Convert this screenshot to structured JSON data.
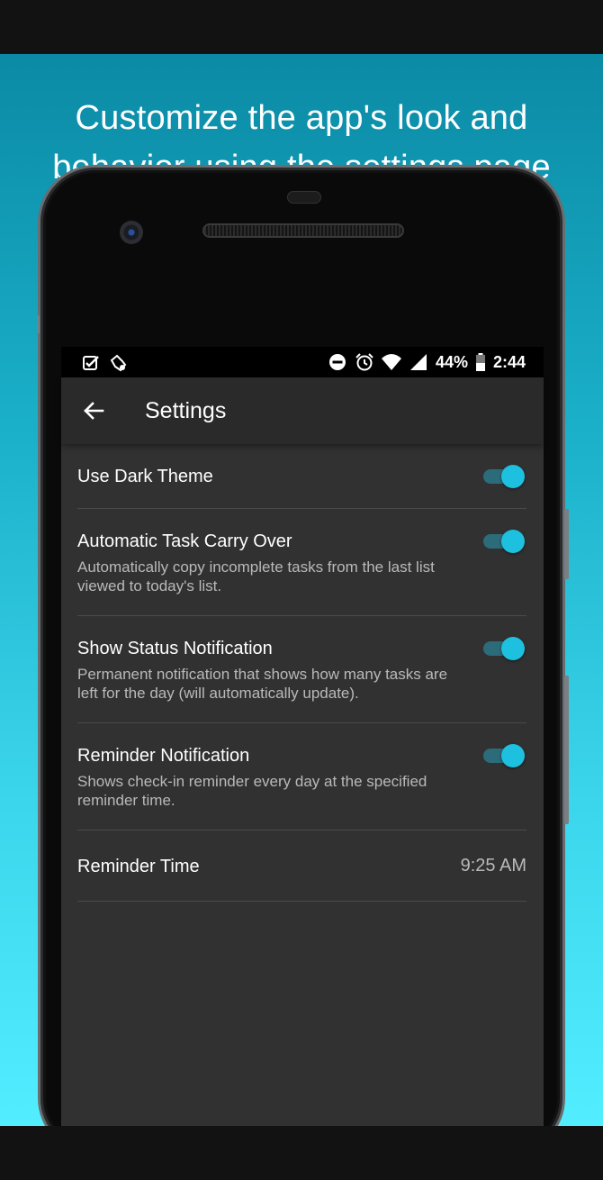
{
  "headline": {
    "line1": "Customize the app's look and",
    "line2": "behavior using the settings page"
  },
  "status_bar": {
    "left_icons": [
      "checkbox-notification-icon",
      "hand-notification-icon"
    ],
    "right_icons": [
      "do-not-disturb-icon",
      "alarm-icon",
      "wifi-icon",
      "signal-icon",
      "battery-icon"
    ],
    "battery": "44%",
    "time": "2:44"
  },
  "app_bar": {
    "back_icon": "arrow-back-icon",
    "title": "Settings"
  },
  "settings": [
    {
      "title": "Use Dark Theme",
      "description": "",
      "enabled": true
    },
    {
      "title": "Automatic Task Carry Over",
      "description": "Automatically copy incomplete tasks from the last list viewed to today's list.",
      "enabled": true
    },
    {
      "title": "Show Status Notification",
      "description": "Permanent notification that shows how many tasks are left for the day (will automatically update).",
      "enabled": true
    },
    {
      "title": "Reminder Notification",
      "description": "Shows check-in reminder every day at the specified reminder time.",
      "enabled": true
    }
  ],
  "reminder_time": {
    "label": "Reminder Time",
    "value": "9:25 AM"
  },
  "colors": {
    "accent": "#1ec0df",
    "switch_track": "#2c6c7a",
    "screen_bg": "#313131",
    "app_bar_bg": "#2a2a2a",
    "gradient_top": "#0b8aa5",
    "gradient_bottom": "#52edff"
  }
}
